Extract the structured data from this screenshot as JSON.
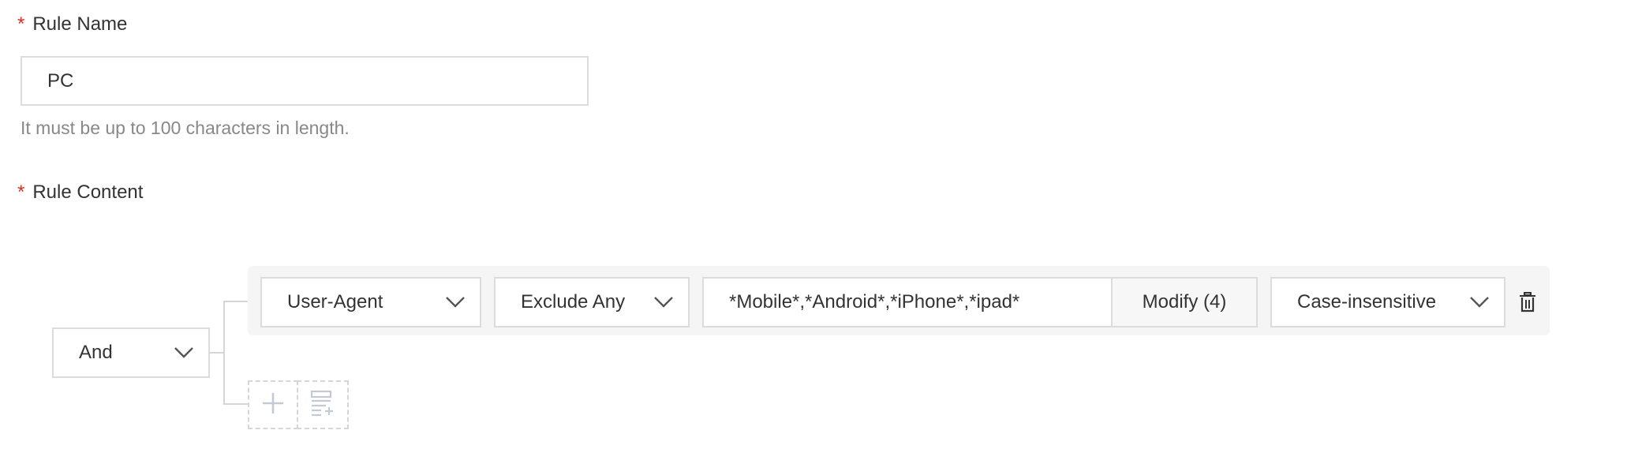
{
  "rule_name": {
    "required_mark": "*",
    "label": "Rule Name",
    "value": "PC",
    "help": "It must be up to 100 characters in length."
  },
  "rule_content": {
    "required_mark": "*",
    "label": "Rule Content",
    "logic_operator": "And",
    "conditions": [
      {
        "field": "User-Agent",
        "operator": "Exclude Any",
        "value": "*Mobile*,*Android*,*iPhone*,*ipad*",
        "modify_label": "Modify (4)",
        "case": "Case-insensitive"
      }
    ]
  },
  "icons": {
    "chevron": "chevron-down-icon",
    "delete": "trash-icon",
    "add": "plus-icon",
    "add_group": "add-condition-group-icon"
  }
}
